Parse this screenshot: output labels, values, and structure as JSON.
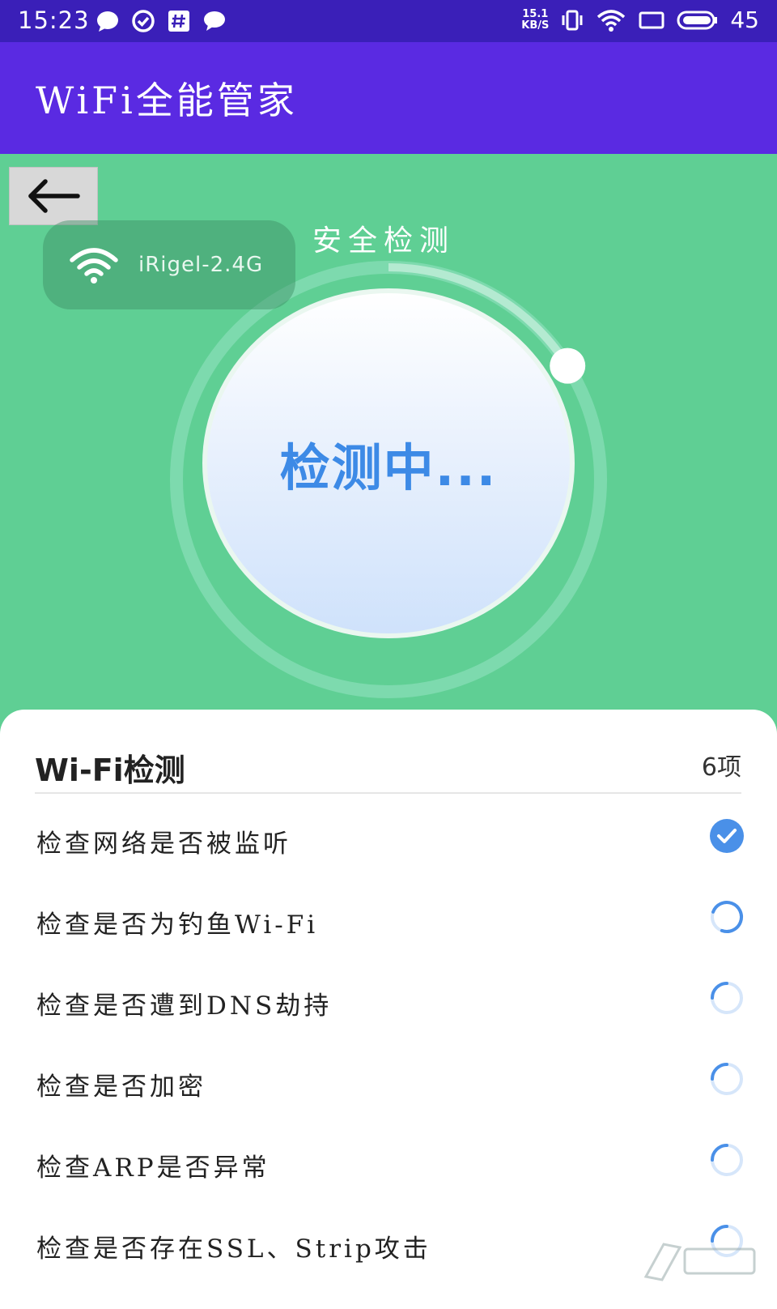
{
  "status_bar": {
    "time": "15:23",
    "net_speed_value": "15.1",
    "net_speed_unit": "KB/S",
    "battery": "45",
    "icons": [
      "chat-bubble-icon",
      "check-circle-icon",
      "hash-icon",
      "message-icon",
      "vibrate-icon",
      "wifi-icon",
      "screen-icon",
      "battery-icon"
    ]
  },
  "app_bar": {
    "title": "WiFi全能管家"
  },
  "hero": {
    "caption": "安全检测",
    "ssid": "iRigel-2.4G",
    "scan_status": "检测中...",
    "progress_percent": 16
  },
  "sheet": {
    "title": "Wi-Fi检测",
    "count": "6项",
    "items": [
      {
        "label": "检查网络是否被监听",
        "state": "done"
      },
      {
        "label": "检查是否为钓鱼Wi-Fi",
        "state": "loading"
      },
      {
        "label": "检查是否遭到DNS劫持",
        "state": "loading"
      },
      {
        "label": "检查是否加密",
        "state": "loading"
      },
      {
        "label": "检查ARP是否异常",
        "state": "loading"
      },
      {
        "label": "检查是否存在SSL、Strip攻击",
        "state": "loading"
      }
    ]
  },
  "colors": {
    "status_bar": "#3a1fb8",
    "app_bar": "#5a2ae2",
    "hero_bg": "#5fcf94",
    "accent_blue": "#3d8ae6",
    "done_blue": "#4a90e8"
  }
}
